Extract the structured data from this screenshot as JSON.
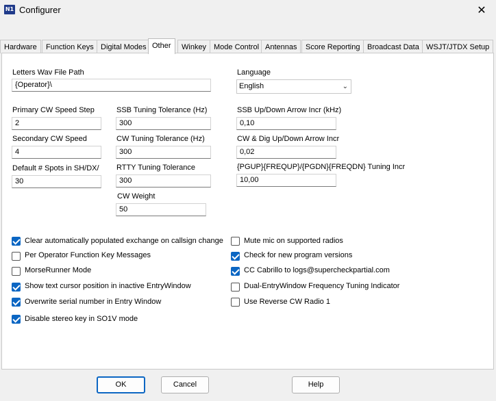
{
  "window": {
    "title": "Configurer",
    "icon": "n1mm-app-icon",
    "close_glyph": "✕"
  },
  "tabs": [
    {
      "label": "Hardware",
      "active": false
    },
    {
      "label": "Function Keys",
      "active": false
    },
    {
      "label": "Digital Modes",
      "active": false
    },
    {
      "label": "Other",
      "active": true
    },
    {
      "label": "Winkey",
      "active": false
    },
    {
      "label": "Mode Control",
      "active": false
    },
    {
      "label": "Antennas",
      "active": false
    },
    {
      "label": "Score Reporting",
      "active": false
    },
    {
      "label": "Broadcast Data",
      "active": false
    },
    {
      "label": "WSJT/JTDX Setup",
      "active": false
    }
  ],
  "fields": {
    "wav_path": {
      "label": "Letters Wav File Path",
      "value": "{Operator}\\"
    },
    "language": {
      "label": "Language",
      "value": "English"
    },
    "primary_cw": {
      "label": "Primary CW Speed Step",
      "value": "2"
    },
    "secondary_cw": {
      "label": "Secondary CW Speed",
      "value": "4"
    },
    "spots": {
      "label": "Default # Spots in SH/DX/",
      "value": "30"
    },
    "ssb_tol": {
      "label": "SSB Tuning Tolerance (Hz)",
      "value": "300"
    },
    "cw_tol": {
      "label": "CW Tuning Tolerance (Hz)",
      "value": "300"
    },
    "rtty_tol": {
      "label": "RTTY Tuning Tolerance",
      "value": "300"
    },
    "cw_weight": {
      "label": "CW Weight",
      "value": "50"
    },
    "ssb_arrow": {
      "label": "SSB Up/Down Arrow Incr (kHz)",
      "value": "0,10"
    },
    "cw_arrow": {
      "label": "CW & Dig Up/Down Arrow Incr",
      "value": "0,02"
    },
    "pgup": {
      "label": "{PGUP}{FREQUP}/{PGDN}{FREQDN} Tuning Incr",
      "value": "10,00"
    }
  },
  "checkboxes_left": [
    {
      "label": "Clear automatically populated exchange on callsign change",
      "checked": true
    },
    {
      "label": "Per Operator Function Key Messages",
      "checked": false
    },
    {
      "label": "MorseRunner Mode",
      "checked": false
    },
    {
      "label": "Show text cursor position in inactive EntryWindow",
      "checked": true
    },
    {
      "label": "Overwrite serial number in Entry Window",
      "checked": true
    },
    {
      "label": "Disable stereo key in SO1V mode",
      "checked": true
    }
  ],
  "checkboxes_right": [
    {
      "label": "Mute mic on supported radios",
      "checked": false
    },
    {
      "label": "Check for new program versions",
      "checked": true
    },
    {
      "label": "CC Cabrillo to logs@supercheckpartial.com",
      "checked": true
    },
    {
      "label": "Dual-EntryWindow Frequency Tuning Indicator",
      "checked": false
    },
    {
      "label": "Use Reverse CW Radio 1",
      "checked": false
    }
  ],
  "buttons": {
    "ok": "OK",
    "cancel": "Cancel",
    "help": "Help"
  },
  "colors": {
    "accent": "#0b66c3",
    "panel": "#ffffff",
    "chrome": "#f0f0f0"
  }
}
